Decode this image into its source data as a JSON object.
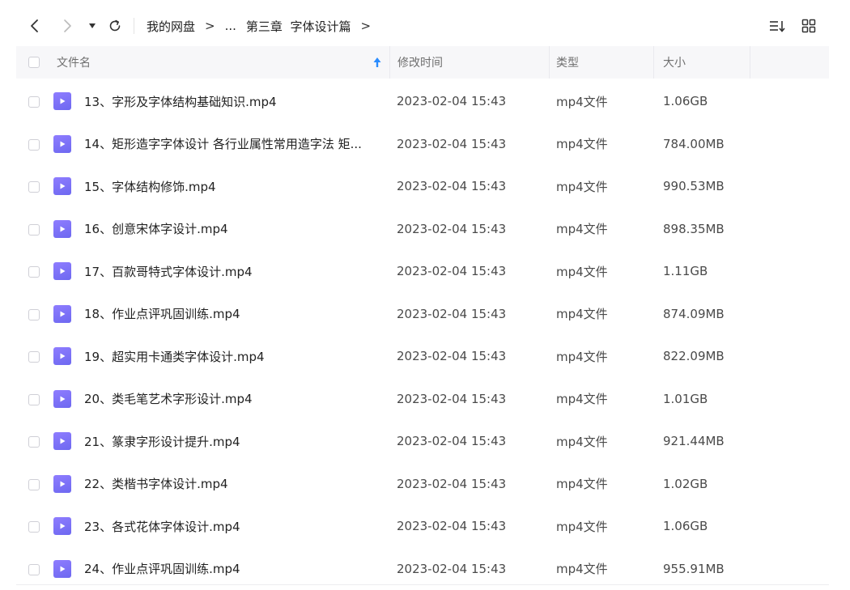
{
  "toolbar": {
    "back_icon": "chevron-left-icon",
    "forward_icon": "chevron-right-icon",
    "dropdown_icon": "caret-down-icon",
    "refresh_icon": "refresh-icon",
    "sort_view_icon": "sort-list-icon",
    "grid_view_icon": "grid-view-icon"
  },
  "breadcrumb": {
    "root": "我的网盘",
    "separator": ">",
    "ellipsis": "...",
    "current": "第三章  字体设计篇"
  },
  "columns": {
    "name": "文件名",
    "modified": "修改时间",
    "type": "类型",
    "size": "大小"
  },
  "colors": {
    "accent": "#2a8cff",
    "file_icon": "#7a72f6"
  },
  "files": [
    {
      "name": "13、字形及字体结构基础知识.mp4",
      "modified": "2023-02-04 15:43",
      "type": "mp4文件",
      "size": "1.06GB"
    },
    {
      "name": "14、矩形造字字体设计 各行业属性常用造字法 矩...",
      "modified": "2023-02-04 15:43",
      "type": "mp4文件",
      "size": "784.00MB"
    },
    {
      "name": "15、字体结构修饰.mp4",
      "modified": "2023-02-04 15:43",
      "type": "mp4文件",
      "size": "990.53MB"
    },
    {
      "name": "16、创意宋体字设计.mp4",
      "modified": "2023-02-04 15:43",
      "type": "mp4文件",
      "size": "898.35MB"
    },
    {
      "name": "17、百款哥特式字体设计.mp4",
      "modified": "2023-02-04 15:43",
      "type": "mp4文件",
      "size": "1.11GB"
    },
    {
      "name": "18、作业点评巩固训练.mp4",
      "modified": "2023-02-04 15:43",
      "type": "mp4文件",
      "size": "874.09MB"
    },
    {
      "name": "19、超实用卡通类字体设计.mp4",
      "modified": "2023-02-04 15:43",
      "type": "mp4文件",
      "size": "822.09MB"
    },
    {
      "name": "20、类毛笔艺术字形设计.mp4",
      "modified": "2023-02-04 15:43",
      "type": "mp4文件",
      "size": "1.01GB"
    },
    {
      "name": "21、篆隶字形设计提升.mp4",
      "modified": "2023-02-04 15:43",
      "type": "mp4文件",
      "size": "921.44MB"
    },
    {
      "name": "22、类楷书字体设计.mp4",
      "modified": "2023-02-04 15:43",
      "type": "mp4文件",
      "size": "1.02GB"
    },
    {
      "name": "23、各式花体字体设计.mp4",
      "modified": "2023-02-04 15:43",
      "type": "mp4文件",
      "size": "1.06GB"
    },
    {
      "name": "24、作业点评巩固训练.mp4",
      "modified": "2023-02-04 15:43",
      "type": "mp4文件",
      "size": "955.91MB"
    }
  ]
}
